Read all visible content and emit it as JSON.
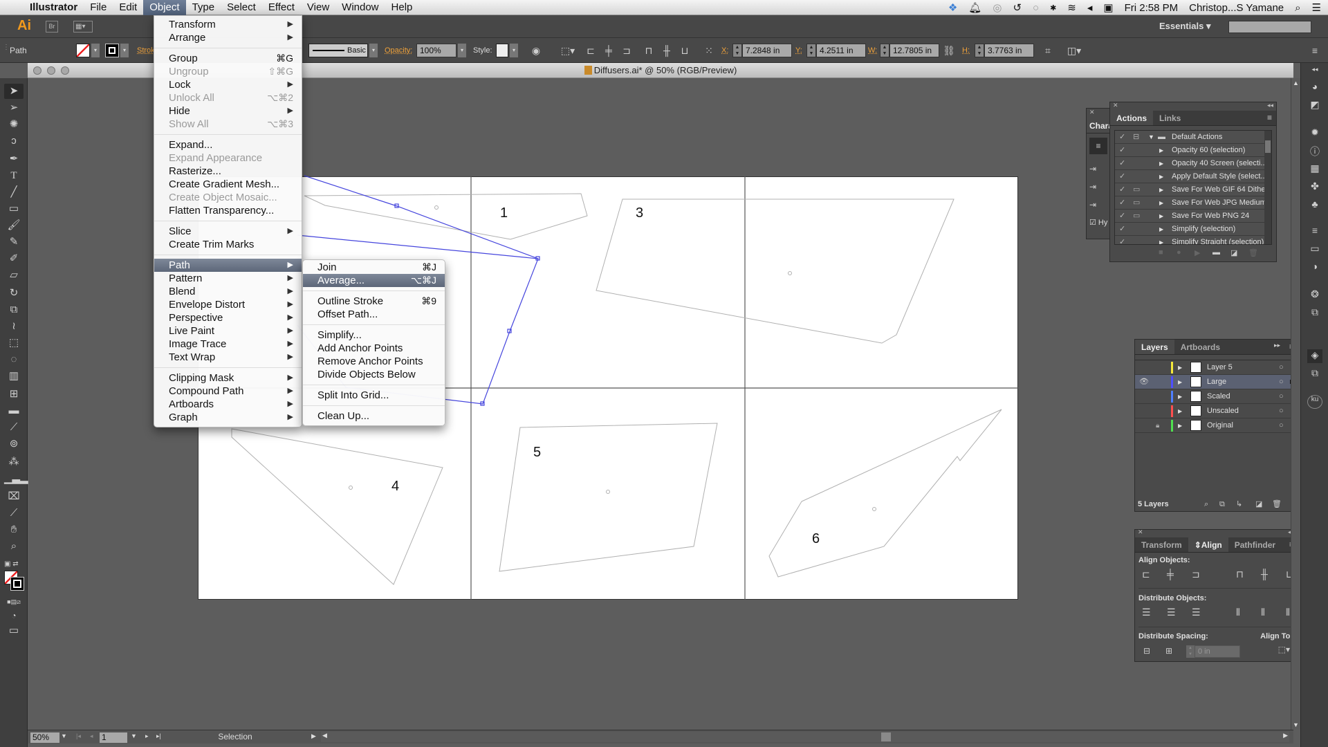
{
  "menubar": {
    "app": "Illustrator",
    "items": [
      "File",
      "Edit",
      "Object",
      "Type",
      "Select",
      "Effect",
      "View",
      "Window",
      "Help"
    ],
    "active": "Object",
    "clock": "Fri 2:58 PM",
    "user": "Christop...S Yamane"
  },
  "appbar": {
    "logo": "Ai",
    "workspace": "Essentials",
    "search_placeholder": ""
  },
  "control_bar": {
    "selection_type": "Path",
    "stroke_label": "Stroke:",
    "brush_label": "Basic",
    "opacity_label": "Opacity:",
    "opacity_value": "100%",
    "style_label": "Style:",
    "x_label": "X:",
    "x_value": "7.2848 in",
    "y_label": "Y:",
    "y_value": "4.2511 in",
    "w_label": "W:",
    "w_value": "12.7805 in",
    "h_label": "H:",
    "h_value": "3.7763 in"
  },
  "document": {
    "title": "Diffusers.ai* @ 50% (RGB/Preview)"
  },
  "object_menu": {
    "items": [
      {
        "label": "Transform",
        "submenu": true
      },
      {
        "label": "Arrange",
        "submenu": true
      },
      {
        "sep": true
      },
      {
        "label": "Group",
        "shortcut": "⌘G"
      },
      {
        "label": "Ungroup",
        "shortcut": "⇧⌘G",
        "disabled": true
      },
      {
        "label": "Lock",
        "submenu": true
      },
      {
        "label": "Unlock All",
        "shortcut": "⌥⌘2",
        "disabled": true
      },
      {
        "label": "Hide",
        "submenu": true
      },
      {
        "label": "Show All",
        "shortcut": "⌥⌘3",
        "disabled": true
      },
      {
        "sep": true
      },
      {
        "label": "Expand..."
      },
      {
        "label": "Expand Appearance",
        "disabled": true
      },
      {
        "label": "Rasterize..."
      },
      {
        "label": "Create Gradient Mesh..."
      },
      {
        "label": "Create Object Mosaic...",
        "disabled": true
      },
      {
        "label": "Flatten Transparency..."
      },
      {
        "sep": true
      },
      {
        "label": "Slice",
        "submenu": true
      },
      {
        "label": "Create Trim Marks"
      },
      {
        "sep": true
      },
      {
        "label": "Path",
        "submenu": true,
        "highlighted": true
      },
      {
        "label": "Pattern",
        "submenu": true
      },
      {
        "label": "Blend",
        "submenu": true
      },
      {
        "label": "Envelope Distort",
        "submenu": true
      },
      {
        "label": "Perspective",
        "submenu": true
      },
      {
        "label": "Live Paint",
        "submenu": true
      },
      {
        "label": "Image Trace",
        "submenu": true
      },
      {
        "label": "Text Wrap",
        "submenu": true
      },
      {
        "sep": true
      },
      {
        "label": "Clipping Mask",
        "submenu": true
      },
      {
        "label": "Compound Path",
        "submenu": true
      },
      {
        "label": "Artboards",
        "submenu": true
      },
      {
        "label": "Graph",
        "submenu": true
      }
    ]
  },
  "path_submenu": {
    "items": [
      {
        "label": "Join",
        "shortcut": "⌘J"
      },
      {
        "label": "Average...",
        "shortcut": "⌥⌘J",
        "highlighted": true
      },
      {
        "sep": true
      },
      {
        "label": "Outline Stroke",
        "shortcut": "⌘9"
      },
      {
        "label": "Offset Path..."
      },
      {
        "sep": true
      },
      {
        "label": "Simplify..."
      },
      {
        "label": "Add Anchor Points"
      },
      {
        "label": "Remove Anchor Points"
      },
      {
        "label": "Divide Objects Below"
      },
      {
        "sep": true
      },
      {
        "label": "Split Into Grid..."
      },
      {
        "sep": true
      },
      {
        "label": "Clean Up..."
      }
    ]
  },
  "artboard_labels": [
    "1",
    "3",
    "4",
    "5",
    "6"
  ],
  "character_panel": {
    "tab": "Chara",
    "hyphenate_label": "Hy"
  },
  "actions_panel": {
    "tabs": [
      "Actions",
      "Links"
    ],
    "active_tab": "Actions",
    "set_name": "Default Actions",
    "actions": [
      {
        "label": "Opacity 60 (selection)",
        "dialog": false
      },
      {
        "label": "Opacity 40 Screen (selecti...",
        "dialog": false
      },
      {
        "label": "Apply Default Style (select...",
        "dialog": false
      },
      {
        "label": "Save For Web GIF 64 Dithe...",
        "dialog": true
      },
      {
        "label": "Save For Web JPG Medium",
        "dialog": true
      },
      {
        "label": "Save For Web PNG 24",
        "dialog": true
      },
      {
        "label": "Simplify (selection)",
        "dialog": false
      },
      {
        "label": "Simplify Straight (selection)",
        "dialog": false
      }
    ]
  },
  "layers_panel": {
    "tabs": [
      "Layers",
      "Artboards"
    ],
    "active_tab": "Layers",
    "layers": [
      {
        "name": "Layer 5",
        "color": "#f5e93a",
        "visible": false,
        "locked": false,
        "selected": false
      },
      {
        "name": "Large",
        "color": "#4f4fff",
        "visible": true,
        "locked": false,
        "selected": true
      },
      {
        "name": "Scaled",
        "color": "#4f7fff",
        "visible": false,
        "locked": false,
        "selected": false
      },
      {
        "name": "Unscaled",
        "color": "#ff4f4f",
        "visible": false,
        "locked": false,
        "selected": false
      },
      {
        "name": "Original",
        "color": "#4fdf4f",
        "visible": false,
        "locked": true,
        "selected": false
      }
    ],
    "count_label": "5 Layers"
  },
  "align_panel": {
    "tabs": [
      "Transform",
      "Align",
      "Pathfinder"
    ],
    "active_tab": "Align",
    "align_objects_label": "Align Objects:",
    "distribute_objects_label": "Distribute Objects:",
    "distribute_spacing_label": "Distribute Spacing:",
    "align_to_label": "Align To:",
    "spacing_value": "0 in"
  },
  "statusbar": {
    "zoom": "50%",
    "artboard": "1",
    "tool": "Selection"
  }
}
